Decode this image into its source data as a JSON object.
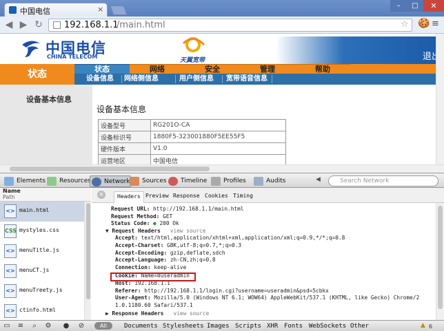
{
  "browser": {
    "tab_title": "中国电信",
    "tab_close": "×",
    "url_host": "192.168.1.1",
    "url_path": "/main.html",
    "star": "☆",
    "win_min": "–",
    "win_max": "□",
    "win_close": "✕"
  },
  "page": {
    "logo_cn": "中国电信",
    "logo_en": "CHINA TELECOM",
    "tianyi": "天翼宽带",
    "exit": "退出",
    "side_heading": "状态",
    "nav": [
      "状态",
      "网络",
      "安全",
      "管理",
      "帮助"
    ],
    "subnav": [
      "设备信息",
      "网络侧信息",
      "用户侧信息",
      "宽带语音信息"
    ],
    "side_item": "设备基本信息",
    "section_title": "设备基本信息",
    "info": [
      {
        "k": "设备型号",
        "v": "RG201O-CA"
      },
      {
        "k": "设备标识号",
        "v": "1880F5-323001880F5EE55F5"
      },
      {
        "k": "硬件版本",
        "v": "V1.0"
      },
      {
        "k": "运营地区",
        "v": "中国电信"
      }
    ]
  },
  "devtools": {
    "tabs": [
      "Elements",
      "Resources",
      "Network",
      "Sources",
      "Timeline",
      "Profiles",
      "Audits"
    ],
    "search_placeholder": "Search Network",
    "list_header_name": "Name",
    "list_header_path": "Path",
    "resources": [
      {
        "name": "main.html",
        "icon": "<>"
      },
      {
        "name": "mystyles.css",
        "icon": "CSS"
      },
      {
        "name": "menuTitle.js",
        "icon": "<>"
      },
      {
        "name": "menuCT.js",
        "icon": "<>"
      },
      {
        "name": "menuTreety.js",
        "icon": "<>"
      },
      {
        "name": "ctinfo.html",
        "icon": "<>"
      }
    ],
    "detail_tabs": [
      "Headers",
      "Preview",
      "Response",
      "Cookies",
      "Timing"
    ],
    "general": [
      {
        "k": "Request URL:",
        "v": "http://192.168.1.1/main.html"
      },
      {
        "k": "Request Method:",
        "v": "GET"
      },
      {
        "k": "Status Code:",
        "v": "200 Ok"
      }
    ],
    "req_headers_label": "Request Headers",
    "view_source": "view source",
    "req_headers": [
      {
        "k": "Accept:",
        "v": "text/html,application/xhtml+xml,application/xml;q=0.9,*/*;q=0.8"
      },
      {
        "k": "Accept-Charset:",
        "v": "GBK,utf-8;q=0.7,*;q=0.3"
      },
      {
        "k": "Accept-Encoding:",
        "v": "gzip,deflate,sdch"
      },
      {
        "k": "Accept-Language:",
        "v": "zh-CN,zh;q=0.8"
      },
      {
        "k": "Connection:",
        "v": "keep-alive"
      },
      {
        "k": "Cookie:",
        "v": "Name=0useradmin"
      },
      {
        "k": "Host:",
        "v": "192.168.1.1"
      },
      {
        "k": "Referer:",
        "v": "http://192.168.1.1/login.cgi?username=useradmin&psd=5cbkx"
      },
      {
        "k": "User-Agent:",
        "v": "Mozilla/5.0 (Windows NT 6.1; WOW64) AppleWebKit/537.1 (KHTML, like Gecko) Chrome/2"
      },
      {
        "k": "",
        "v": "1.0.1180.60 Safari/537.1"
      }
    ],
    "resp_headers_label": "Response Headers",
    "status_filters": [
      "All",
      "Documents",
      "Stylesheets",
      "Images",
      "Scripts",
      "XHR",
      "Fonts",
      "WebSockets",
      "Other"
    ],
    "warning_count": "6",
    "colors": {
      "accent_orange": "#f08a1d",
      "nav_blue": "#2d6fa8",
      "highlight_red": "#d01515"
    }
  }
}
